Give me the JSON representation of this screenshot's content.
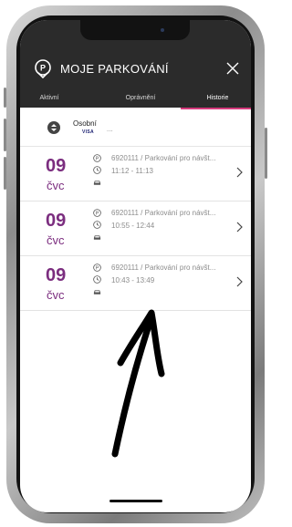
{
  "header": {
    "title": "MOJE PARKOVÁNÍ",
    "tabs": [
      {
        "label": "Aktivní"
      },
      {
        "label": "Oprávnění"
      },
      {
        "label": "Historie"
      }
    ],
    "active_tab": "Historie",
    "accent_color": "#d63b7d",
    "background_color": "#2b2b2b"
  },
  "vehicle": {
    "name": "Osobní",
    "card_brand": "VISA",
    "card_masked": "...."
  },
  "history": [
    {
      "day": "09",
      "month": "čvc",
      "zone": "6920111 / Parkování pro návšt...",
      "time": "11:12 - 11:13"
    },
    {
      "day": "09",
      "month": "čvc",
      "zone": "6920111 / Parkování pro návšt...",
      "time": "10:55 - 12:44"
    },
    {
      "day": "09",
      "month": "čvc",
      "zone": "6920111 / Parkování pro návšt...",
      "time": "10:43 - 13:49"
    }
  ],
  "icons": {
    "header_left": "parking-pin-icon",
    "header_right": "close-icon",
    "vehicle": "sort-icon",
    "row_zone": "parking-icon",
    "row_time": "clock-icon",
    "row_vehicle": "car-icon",
    "row_action": "chevron-right-icon"
  },
  "date_color": "#7b2d7f"
}
